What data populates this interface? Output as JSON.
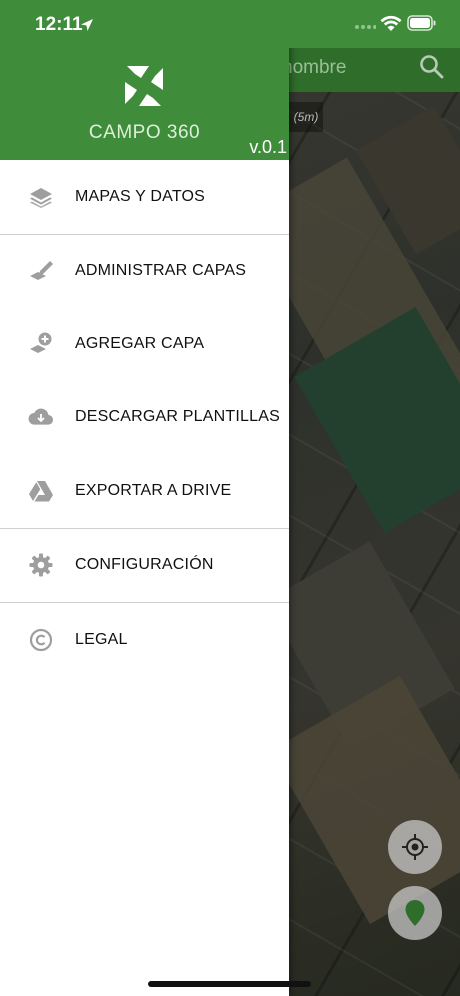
{
  "status_bar": {
    "time": "12:11"
  },
  "map": {
    "search_placeholder": "nombre",
    "scale_label": "(5m)"
  },
  "drawer": {
    "brand": "CAMPO 360",
    "version": "v.0.1",
    "items": [
      {
        "label": "MAPAS Y DATOS",
        "icon": "layers-icon"
      },
      {
        "label": "ADMINISTRAR CAPAS",
        "icon": "edit-layers-icon"
      },
      {
        "label": "AGREGAR CAPA",
        "icon": "add-layer-icon"
      },
      {
        "label": "DESCARGAR PLANTILLAS",
        "icon": "cloud-download-icon"
      },
      {
        "label": "EXPORTAR A DRIVE",
        "icon": "drive-icon"
      },
      {
        "label": "CONFIGURACIÓN",
        "icon": "gear-icon"
      },
      {
        "label": "LEGAL",
        "icon": "copyright-icon"
      }
    ]
  },
  "colors": {
    "header_green": "#3f8c3a",
    "icon_gray": "#9e9e9e"
  }
}
